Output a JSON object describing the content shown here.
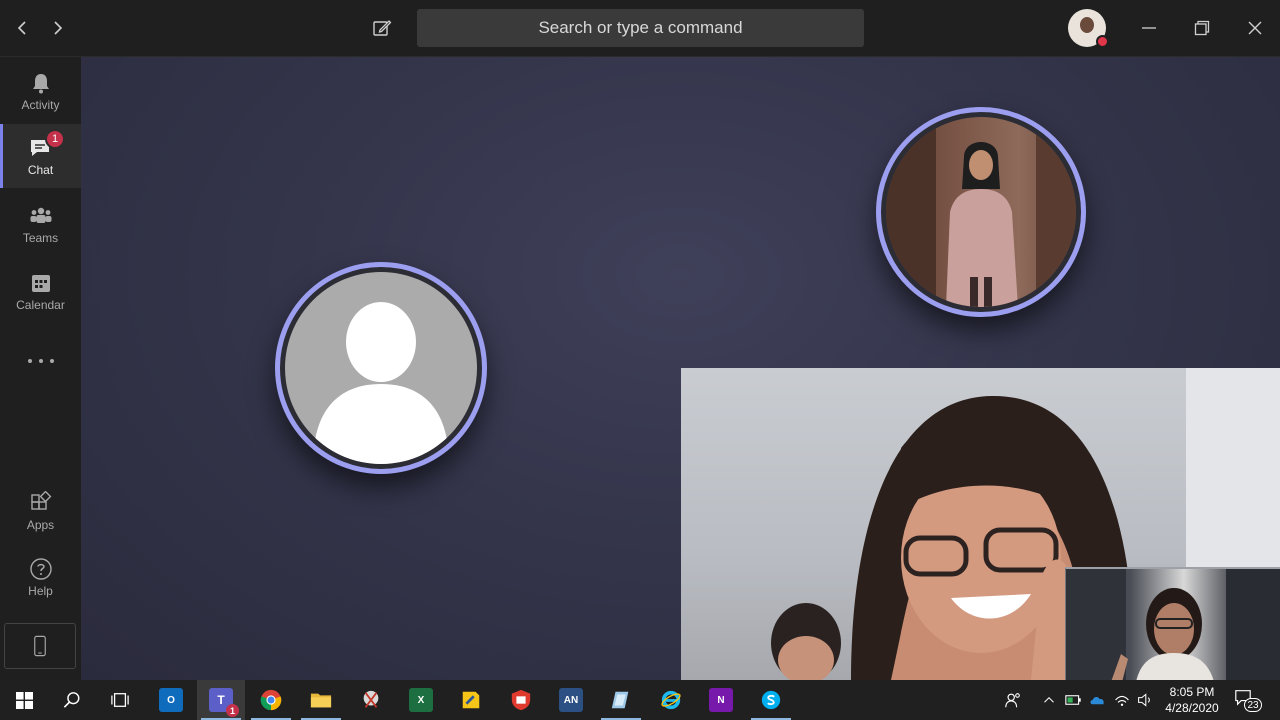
{
  "titlebar": {
    "search_placeholder": "Search or type a command"
  },
  "rail": {
    "items": [
      {
        "label": "Activity",
        "icon": "bell-icon"
      },
      {
        "label": "Chat",
        "icon": "chat-icon",
        "badge": "1"
      },
      {
        "label": "Teams",
        "icon": "teams-icon"
      },
      {
        "label": "Calendar",
        "icon": "calendar-icon"
      },
      {
        "label": "Apps",
        "icon": "apps-icon"
      },
      {
        "label": "Help",
        "icon": "help-icon"
      }
    ]
  },
  "taskbar": {
    "teams_badge": "1",
    "anydesk_label": "AN",
    "excel_label": "X",
    "outlook_label": "O",
    "onenote_label": "N",
    "clock_time": "8:05 PM",
    "clock_date": "4/28/2020",
    "notification_count": "23"
  },
  "colors": {
    "accent": "#7b83eb",
    "participant_ring": "#9c9ef0",
    "badge": "#c4314b",
    "status_busy": "#e0364a"
  }
}
